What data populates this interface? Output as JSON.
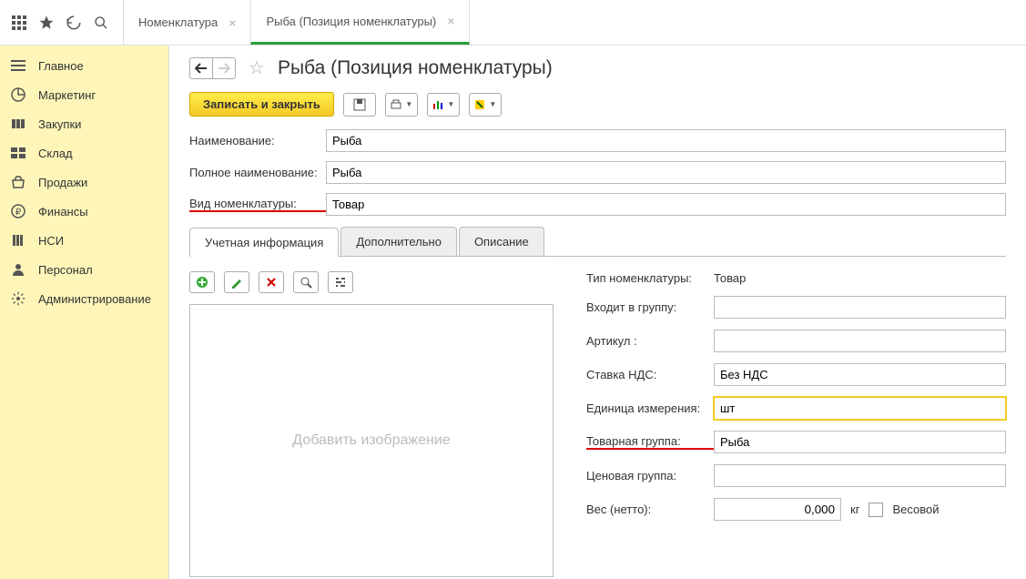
{
  "topTabs": [
    {
      "label": "Номенклатура"
    },
    {
      "label": "Рыба (Позиция номенклатуры)"
    }
  ],
  "sidebar": [
    {
      "label": "Главное"
    },
    {
      "label": "Маркетинг"
    },
    {
      "label": "Закупки"
    },
    {
      "label": "Склад"
    },
    {
      "label": "Продажи"
    },
    {
      "label": "Финансы"
    },
    {
      "label": "НСИ"
    },
    {
      "label": "Персонал"
    },
    {
      "label": "Администрирование"
    }
  ],
  "pageTitle": "Рыба (Позиция номенклатуры)",
  "saveCloseLabel": "Записать и закрыть",
  "form": {
    "nameLabel": "Наименование:",
    "nameValue": "Рыба",
    "fullNameLabel": "Полное наименование:",
    "fullNameValue": "Рыба",
    "kindLabel": "Вид номенклатуры:",
    "kindValue": "Товар"
  },
  "subtabs": [
    {
      "label": "Учетная информация"
    },
    {
      "label": "Дополнительно"
    },
    {
      "label": "Описание"
    }
  ],
  "imagePlaceholder": "Добавить изображение",
  "props": {
    "typeLabel": "Тип номенклатуры:",
    "typeValue": "Товар",
    "groupLabel": "Входит в группу:",
    "groupValue": "",
    "articleLabel": "Артикул :",
    "articleValue": "",
    "vatLabel": "Ставка НДС:",
    "vatValue": "Без НДС",
    "unitLabel": "Единица измерения:",
    "unitValue": "шт",
    "prodGroupLabel": "Товарная группа:",
    "prodGroupValue": "Рыба",
    "priceGroupLabel": "Ценовая группа:",
    "priceGroupValue": "",
    "weightLabel": "Вес (нетто):",
    "weightValue": "0,000",
    "weightUnit": "кг",
    "weightCheckLabel": "Весовой"
  }
}
